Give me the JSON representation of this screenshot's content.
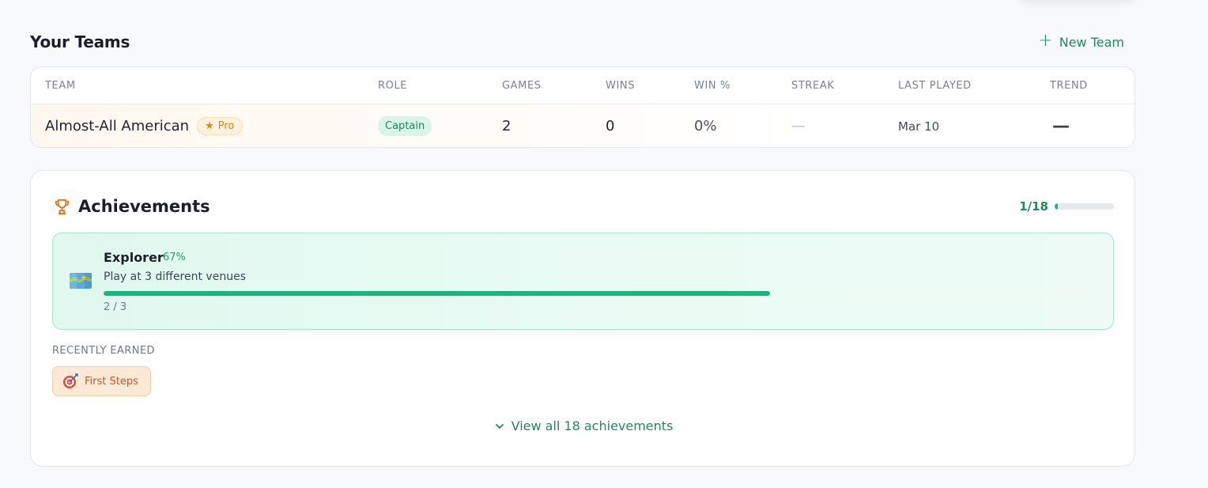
{
  "teams": {
    "title": "Your Teams",
    "new_team_label": "New Team",
    "columns": [
      "TEAM",
      "ROLE",
      "GAMES",
      "WINS",
      "WIN %",
      "STREAK",
      "LAST PLAYED",
      "TREND"
    ],
    "rows": [
      {
        "team": "Almost-All American",
        "badge": "Pro",
        "role": "Captain",
        "games": "2",
        "wins": "0",
        "win_pct": "0%",
        "streak": "—",
        "last_played": "Mar 10",
        "trend": "—"
      }
    ]
  },
  "achievements": {
    "title": "Achievements",
    "progress_label": "1/18",
    "progress_fraction": 0.056,
    "in_progress": {
      "name": "Explorer",
      "percent_label": "67%",
      "description": "Play at 3 different venues",
      "count_label": "2 / 3",
      "fraction": 0.67
    },
    "recent_label": "RECENTLY EARNED",
    "recent": [
      {
        "name": "First Steps",
        "icon": "target-icon"
      }
    ],
    "view_all_label": "View all 18 achievements"
  },
  "colors": {
    "accent_green": "#1f8a5b",
    "progress_green": "#19b57e",
    "pro_orange": "#d8861e",
    "trophy_orange": "#e07a1f"
  }
}
